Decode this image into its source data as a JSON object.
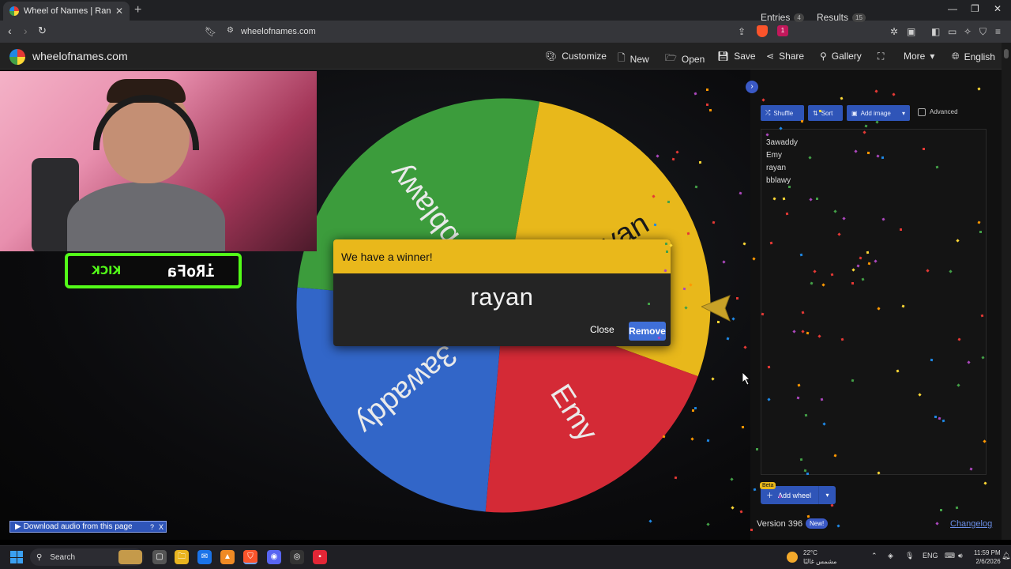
{
  "browser": {
    "tab_title": "Wheel of Names | Random n",
    "url": "wheelofnames.com",
    "brave_badge": "1"
  },
  "app": {
    "logo_text": "wheelofnames.com",
    "nav": {
      "customize": "Customize",
      "new": "New",
      "open": "Open",
      "save": "Save",
      "share": "Share",
      "gallery": "Gallery",
      "more": "More",
      "language": "English"
    }
  },
  "stream_overlay": {
    "name": "iRoFa",
    "platform": "KICK"
  },
  "wheel": {
    "segments": [
      {
        "label": "rayan",
        "color": "#e8b81b"
      },
      {
        "label": "Emy",
        "color": "#d42a36"
      },
      {
        "label": "3awaddy",
        "color": "#3266c8"
      },
      {
        "label": "bblawy",
        "color": "#3c9c3c"
      }
    ]
  },
  "dialog": {
    "header": "We have a winner!",
    "winner": "rayan",
    "close_label": "Close",
    "remove_label": "Remove"
  },
  "panel": {
    "tab_entries": "Entries",
    "entries_count": "4",
    "tab_results": "Results",
    "results_count": "15",
    "shuffle_label": "Shuffle",
    "sort_label": "Sort",
    "add_image_label": "Add image",
    "advanced_label": "Advanced",
    "entries": [
      "3awaddy",
      "Emy",
      "rayan",
      "bblawy"
    ],
    "beta_label": "Beta",
    "add_wheel_label": "Add wheel",
    "version_label": "Version 396",
    "new_badge": "New!",
    "changelog_label": "Changelog"
  },
  "download_audio": {
    "label": "Download audio from this page",
    "help": "?",
    "close": "X"
  },
  "taskbar": {
    "search_label": "Search",
    "temperature": "22°C",
    "weather_desc": "مشمس غالبًا",
    "language": "ENG",
    "time": "11:59 PM",
    "date": "2/6/2026"
  }
}
